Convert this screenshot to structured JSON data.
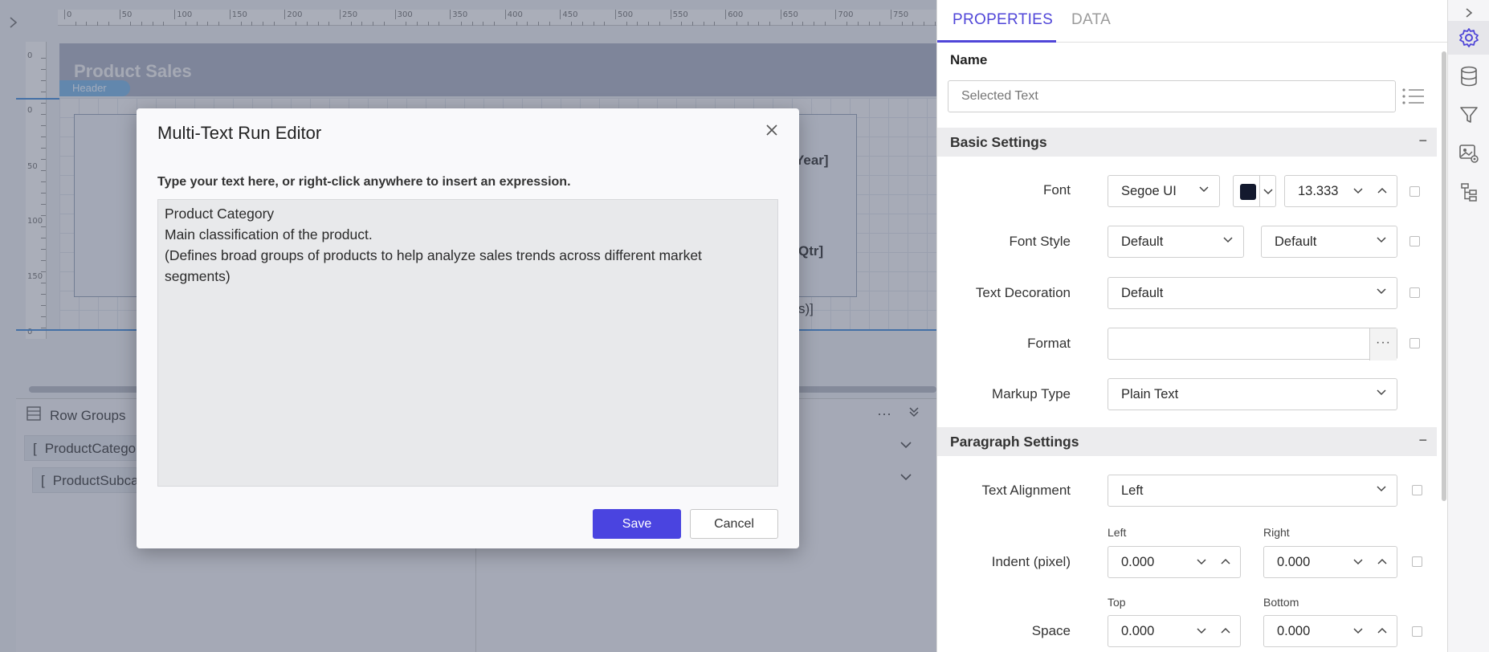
{
  "designer": {
    "report_title": "Product Sales",
    "header_tag": "Header",
    "ruler_top": [
      "0",
      "50",
      "100",
      "150",
      "200",
      "250",
      "300",
      "350",
      "400",
      "450",
      "500",
      "550",
      "600",
      "650",
      "700",
      "750"
    ],
    "ruler_left": [
      "0",
      "0",
      "50",
      "100",
      "150",
      "0"
    ],
    "fragments": {
      "year": "Year]",
      "qtr": "Qtr]",
      "s": "s)]"
    },
    "row_groups": {
      "title": "Row Groups",
      "items": [
        {
          "label": "ProductCatego"
        },
        {
          "label": "ProductSubca"
        }
      ]
    }
  },
  "modal": {
    "title": "Multi-Text Run Editor",
    "hint": "Type your text here, or right-click anywhere to insert an expression.",
    "editor_lines": [
      "Product Category",
      "Main classification of the product.",
      "(Defines broad groups of products to help analyze sales trends across different market segments)"
    ],
    "save_label": "Save",
    "cancel_label": "Cancel"
  },
  "properties": {
    "tabs": {
      "properties": "PROPERTIES",
      "data": "DATA"
    },
    "name_label": "Name",
    "name_placeholder": "Selected Text",
    "basic_settings": {
      "title": "Basic Settings",
      "collapse": "−",
      "font_label": "Font",
      "font_family": "Segoe UI",
      "font_color": "#13192e",
      "font_size": "13.333",
      "font_style_label": "Font Style",
      "font_style_value": "Default",
      "font_weight_value": "Default",
      "text_decoration_label": "Text Decoration",
      "text_decoration_value": "Default",
      "format_label": "Format",
      "format_value": "",
      "format_ellipsis": "···",
      "markup_label": "Markup Type",
      "markup_value": "Plain Text"
    },
    "paragraph_settings": {
      "title": "Paragraph Settings",
      "collapse": "−",
      "text_alignment_label": "Text Alignment",
      "text_alignment_value": "Left",
      "indent_label": "Indent (pixel)",
      "indent_left_label": "Left",
      "indent_right_label": "Right",
      "indent_left": "0.000",
      "indent_right": "0.000",
      "space_label": "Space",
      "space_top_label": "Top",
      "space_bottom_label": "Bottom",
      "space_top": "0.000",
      "space_bottom": "0.000"
    }
  },
  "iconbar": {
    "icons": [
      "chevron-right-icon",
      "settings-icon",
      "database-icon",
      "filter-icon",
      "image-settings-icon",
      "tree-icon"
    ]
  },
  "colors": {
    "accent": "#5046d8",
    "save_button": "#4a44e0",
    "section_bg": "#ececee"
  }
}
